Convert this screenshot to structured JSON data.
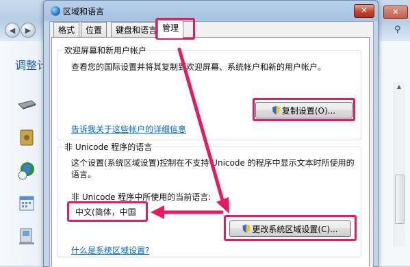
{
  "background_window": {
    "title_partial": "调整计",
    "close_glyph": "✕",
    "back_glyph": "◀",
    "forward_glyph": "▶",
    "search_icon": "search-icon"
  },
  "dialog": {
    "title": "区域和语言",
    "close_glyph": "✕",
    "tabs": [
      {
        "label": "格式"
      },
      {
        "label": "位置"
      },
      {
        "label": "键盘和语言"
      },
      {
        "label": "管理"
      }
    ],
    "active_tab": "管理",
    "welcome_group": {
      "title": "欢迎屏幕和新用户帐户",
      "description": "查看您的国际设置并将其复制到欢迎屏幕、系统帐户和新的用户帐户。",
      "copy_button": "复制设置(O)...",
      "link": "告诉我关于这些帐户的详细信息"
    },
    "unicode_group": {
      "title": "非 Unicode 程序的语言",
      "description": "这个设置(系统区域设置)控制在不支持 Unicode 的程序中显示文本时所使用的语言。",
      "current_label": "非 Unicode 程序中所使用的当前语言:",
      "current_value": "中文(简体，中国",
      "change_button": "更改系统区域设置(C)...",
      "link": "什么是系统区域设置?"
    }
  },
  "colors": {
    "highlight": "#e8195f",
    "link": "#0066cc",
    "dialog_frame": "#a7c3e1"
  }
}
